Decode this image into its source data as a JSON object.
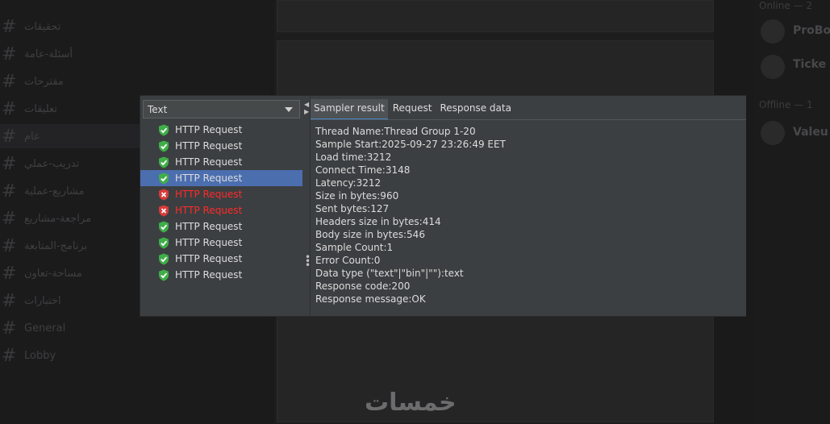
{
  "background": {
    "channels": [
      "تحقيقات",
      "أسئلة-عامة",
      "مقترحات",
      "تعليقات",
      "عام",
      "تدريب-عملي",
      "مشاريع-عملية",
      "مراجعة-مشاريع",
      "برنامج-المتابعة",
      "مساحة-تعاون",
      "اختبارات",
      "General",
      "Lobby"
    ],
    "right_header": "Online — 2",
    "right_header2": "Offline — 1",
    "right_users": [
      "ProBo",
      "Ticke",
      "Valeu"
    ],
    "logo_text": "خمسات"
  },
  "jmeter": {
    "combo_value": "Text",
    "tree_items": [
      {
        "label": "HTTP Request",
        "status": "success"
      },
      {
        "label": "HTTP Request",
        "status": "success"
      },
      {
        "label": "HTTP Request",
        "status": "success"
      },
      {
        "label": "HTTP Request",
        "status": "success",
        "selected": true
      },
      {
        "label": "HTTP Request",
        "status": "fail"
      },
      {
        "label": "HTTP Request",
        "status": "fail"
      },
      {
        "label": "HTTP Request",
        "status": "success"
      },
      {
        "label": "HTTP Request",
        "status": "success"
      },
      {
        "label": "HTTP Request",
        "status": "success"
      },
      {
        "label": "HTTP Request",
        "status": "success"
      }
    ],
    "tabs": [
      "Sampler result",
      "Request",
      "Response data"
    ],
    "active_tab": 0,
    "result_lines": [
      "Thread Name:Thread Group 1-20",
      "Sample Start:2025-09-27 23:26:49 EET",
      "Load time:3212",
      "Connect Time:3148",
      "Latency:3212",
      "Size in bytes:960",
      "Sent bytes:127",
      "Headers size in bytes:414",
      "Body size in bytes:546",
      "Sample Count:1",
      "Error Count:0",
      "Data type (\"text\"|\"bin\"|\"\"):text",
      "Response code:200",
      "Response message:OK"
    ],
    "colors": {
      "selected": "#4b6eaf",
      "fail_text": "#ff2a2a",
      "success_icon": "#3fae49",
      "fail_icon": "#d93a3a"
    }
  }
}
